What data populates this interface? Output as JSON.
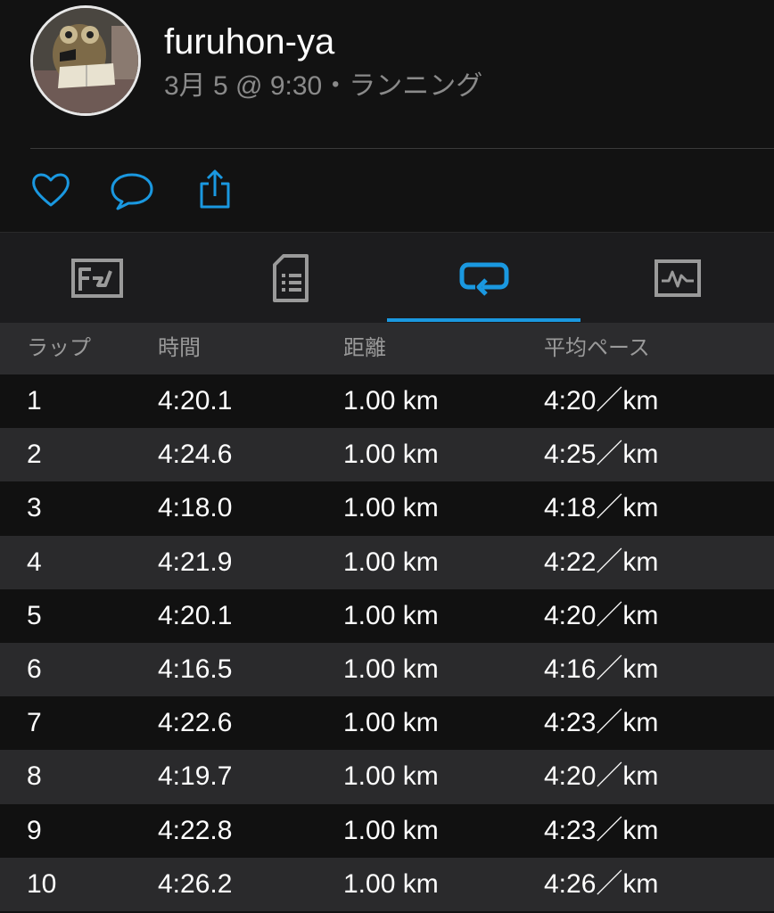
{
  "profile": {
    "username": "furuhon-ya",
    "meta": "3月 5 @ 9:30・ランニング"
  },
  "actions": {
    "like_icon": "heart-icon",
    "comment_icon": "comment-icon",
    "share_icon": "share-icon"
  },
  "tabs": [
    {
      "icon": "stats-card-icon",
      "active": false
    },
    {
      "icon": "details-list-icon",
      "active": false
    },
    {
      "icon": "laps-icon",
      "active": true
    },
    {
      "icon": "chart-icon",
      "active": false
    }
  ],
  "colors": {
    "accent": "#1a98e0",
    "background": "#121212",
    "row_alt": "#2a2a2c",
    "header_row": "#2c2c2e",
    "muted_text": "#8a8a8a"
  },
  "laps": {
    "headers": [
      "ラップ",
      "時間",
      "距離",
      "平均ペース"
    ],
    "rows": [
      [
        "1",
        "4:20.1",
        "1.00 km",
        "4:20／km"
      ],
      [
        "2",
        "4:24.6",
        "1.00 km",
        "4:25／km"
      ],
      [
        "3",
        "4:18.0",
        "1.00 km",
        "4:18／km"
      ],
      [
        "4",
        "4:21.9",
        "1.00 km",
        "4:22／km"
      ],
      [
        "5",
        "4:20.1",
        "1.00 km",
        "4:20／km"
      ],
      [
        "6",
        "4:16.5",
        "1.00 km",
        "4:16／km"
      ],
      [
        "7",
        "4:22.6",
        "1.00 km",
        "4:23／km"
      ],
      [
        "8",
        "4:19.7",
        "1.00 km",
        "4:20／km"
      ],
      [
        "9",
        "4:22.8",
        "1.00 km",
        "4:23／km"
      ],
      [
        "10",
        "4:26.2",
        "1.00 km",
        "4:26／km"
      ]
    ]
  }
}
